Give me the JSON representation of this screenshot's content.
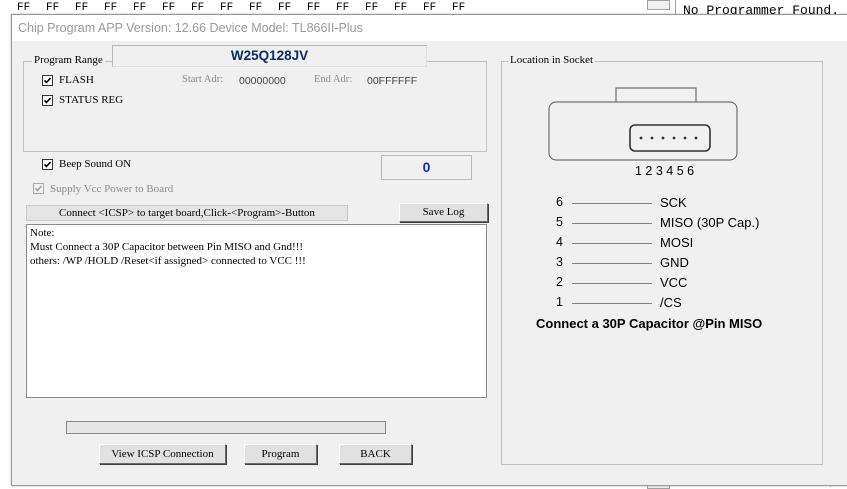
{
  "background": {
    "hex_row": [
      "FF",
      "FF",
      "FF",
      "FF",
      "FF",
      "FF",
      "FF",
      "FF",
      "FF",
      "FF",
      "FF",
      "FF",
      "FF",
      "FF",
      "FF",
      "FF"
    ],
    "right_message": "No Programmer Found."
  },
  "dialog": {
    "title": "Chip Program     APP Version: 12.66 Device Model: TL866II-Plus",
    "device_name": "W25Q128JV",
    "program_range": {
      "label": "Program Range",
      "flash_label": "FLASH",
      "flash_checked": true,
      "status_reg_label": "STATUS REG",
      "status_reg_checked": true,
      "start_adr_label": "Start Adr:",
      "start_adr_value": "00000000",
      "end_adr_label": "End Adr:",
      "end_adr_value": "00FFFFFF"
    },
    "beep_label": "Beep Sound ON",
    "beep_checked": true,
    "counter": "0",
    "vcc_label": "Supply Vcc Power to Board",
    "vcc_checked": true,
    "status_text": "Connect <ICSP> to target board,Click-<Program>-Button",
    "save_log_label": "Save Log",
    "log_lines": [
      "Note:",
      "Must Connect a 30P Capacitor between Pin MISO and Gnd!!!",
      "others: /WP /HOLD /Reset<if assigned>  connected to VCC !!!"
    ],
    "progress": 0,
    "buttons": {
      "view_icsp": "View ICSP Connection",
      "program": "Program",
      "back": "BACK"
    },
    "location": {
      "label": "Location in Socket",
      "pin_numbers": "1 2 3 4 5 6",
      "pins": [
        {
          "num": "6",
          "name": "SCK"
        },
        {
          "num": "5",
          "name": "MISO  (30P Cap.)"
        },
        {
          "num": "4",
          "name": "MOSI"
        },
        {
          "num": "3",
          "name": "GND"
        },
        {
          "num": "2",
          "name": "VCC"
        },
        {
          "num": "1",
          "name": "/CS"
        }
      ],
      "note": "Connect a 30P Capacitor @Pin MISO"
    }
  }
}
